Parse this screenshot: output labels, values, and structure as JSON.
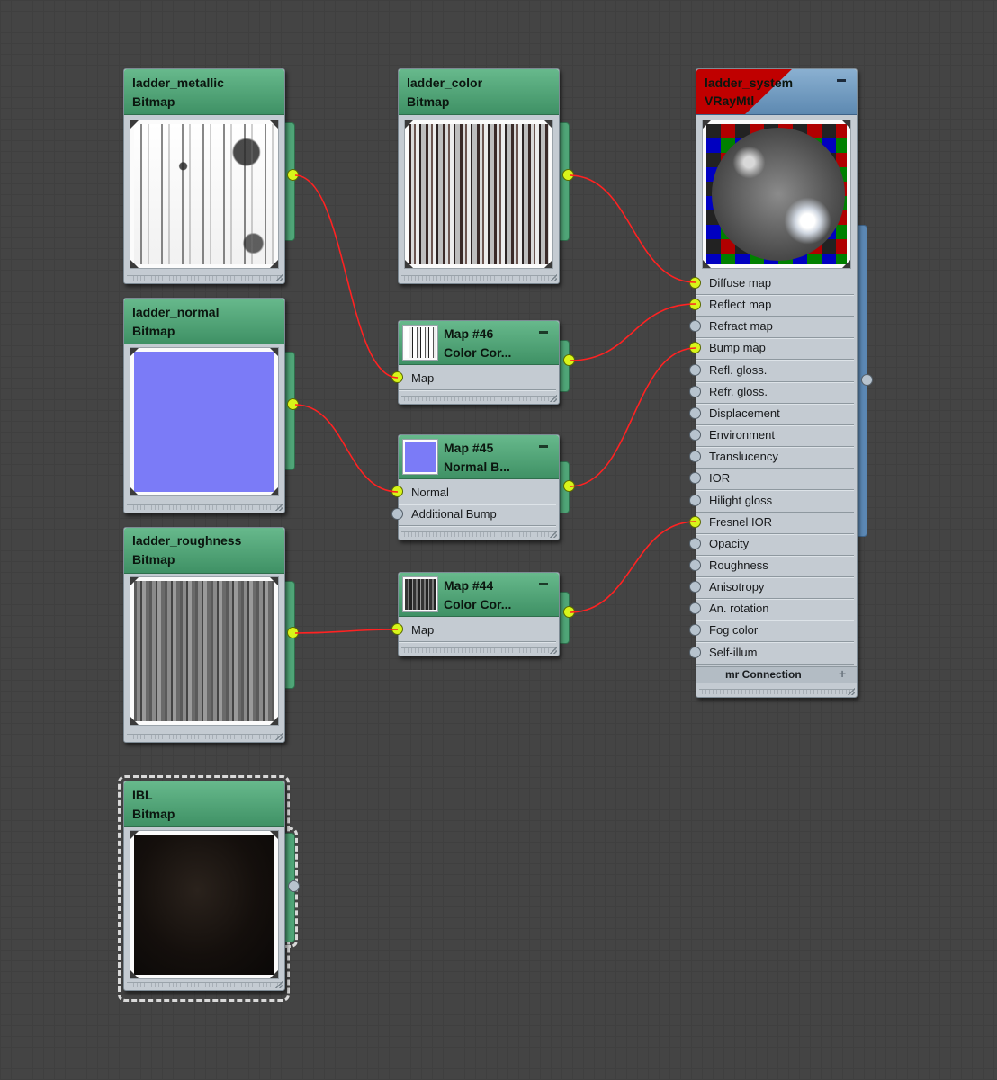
{
  "canvas": {
    "background": "#444444",
    "wire_color": "#ff2222"
  },
  "nodes": {
    "metallic": {
      "name": "ladder_metallic",
      "type": "Bitmap",
      "out_connected": true
    },
    "color": {
      "name": "ladder_color",
      "type": "Bitmap",
      "out_connected": true
    },
    "normal": {
      "name": "ladder_normal",
      "type": "Bitmap",
      "out_connected": true
    },
    "roughness": {
      "name": "ladder_roughness",
      "type": "Bitmap",
      "out_connected": true
    },
    "ibl": {
      "name": "IBL",
      "type": "Bitmap",
      "out_connected": false,
      "selected": true
    },
    "map46": {
      "name": "Map #46",
      "type": "Color  Cor...",
      "slots": [
        "Map"
      ],
      "out_connected": true
    },
    "map45": {
      "name": "Map #45",
      "type": "Normal  B...",
      "slots": [
        "Normal",
        "Additional Bump"
      ],
      "out_connected": true
    },
    "map44": {
      "name": "Map #44",
      "type": "Color  Cor...",
      "slots": [
        "Map"
      ],
      "out_connected": true
    },
    "material": {
      "name": "ladder_system",
      "type": "VRayMtl",
      "slots": [
        {
          "label": "Diffuse map",
          "connected": true
        },
        {
          "label": "Reflect map",
          "connected": true
        },
        {
          "label": "Refract map",
          "connected": false
        },
        {
          "label": "Bump map",
          "connected": true
        },
        {
          "label": "Refl. gloss.",
          "connected": false
        },
        {
          "label": "Refr. gloss.",
          "connected": false
        },
        {
          "label": "Displacement",
          "connected": false
        },
        {
          "label": "Environment",
          "connected": false
        },
        {
          "label": "Translucency",
          "connected": false
        },
        {
          "label": "IOR",
          "connected": false
        },
        {
          "label": "Hilight gloss",
          "connected": false
        },
        {
          "label": "Fresnel IOR",
          "connected": true
        },
        {
          "label": "Opacity",
          "connected": false
        },
        {
          "label": "Roughness",
          "connected": false
        },
        {
          "label": "Anisotropy",
          "connected": false
        },
        {
          "label": "An. rotation",
          "connected": false
        },
        {
          "label": "Fog color",
          "connected": false
        },
        {
          "label": "Self-illum",
          "connected": false
        }
      ],
      "footer": "mr Connection",
      "footer_icon": "plus-icon"
    }
  },
  "connections": [
    {
      "from": "ladder_metallic",
      "to": "Map #46 / Map"
    },
    {
      "from": "ladder_color",
      "to": "ladder_system / Diffuse map"
    },
    {
      "from": "ladder_normal",
      "to": "Map #45 / Normal"
    },
    {
      "from": "ladder_roughness",
      "to": "Map #44 / Map"
    },
    {
      "from": "Map #46",
      "to": "ladder_system / Reflect map"
    },
    {
      "from": "Map #45",
      "to": "ladder_system / Bump map"
    },
    {
      "from": "Map #44",
      "to": "ladder_system / Fresnel IOR"
    }
  ]
}
